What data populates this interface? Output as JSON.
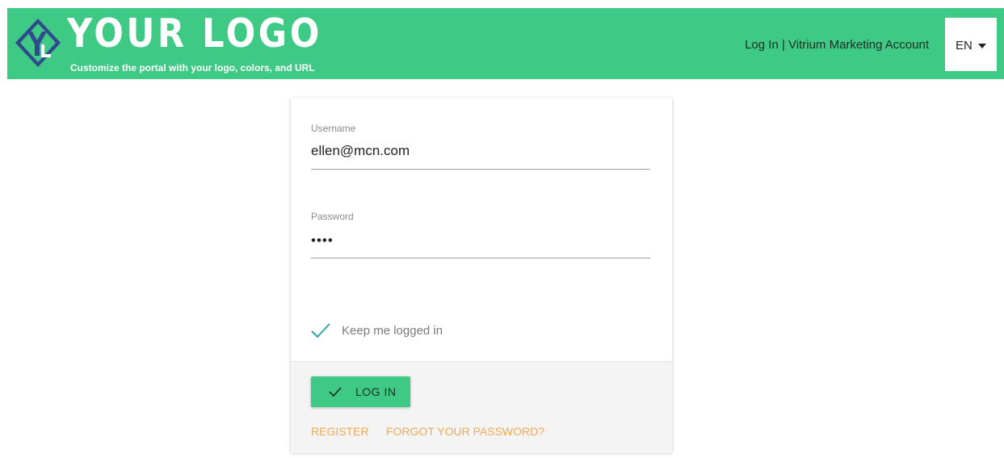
{
  "header": {
    "logo_title": "YOUR LOGO",
    "logo_subtitle": "Customize the portal with your logo, colors, and URL",
    "account_link": "Log In | Vitrium Marketing Account",
    "language": "EN",
    "brand_color": "#3ec985"
  },
  "login_form": {
    "username_label": "Username",
    "username_value": "ellen@mcn.com",
    "password_label": "Password",
    "password_value": "••••",
    "remember_label": "Keep me logged in",
    "remember_checked": true,
    "login_button": "LOG IN",
    "register_link": "REGISTER",
    "forgot_link": "FORGOT YOUR PASSWORD?",
    "link_color": "#f0a951"
  },
  "icons": {
    "logo": "yl-logo-icon",
    "language_caret": "caret-down-icon",
    "remember": "checkmark-icon",
    "login": "checkmark-icon"
  }
}
